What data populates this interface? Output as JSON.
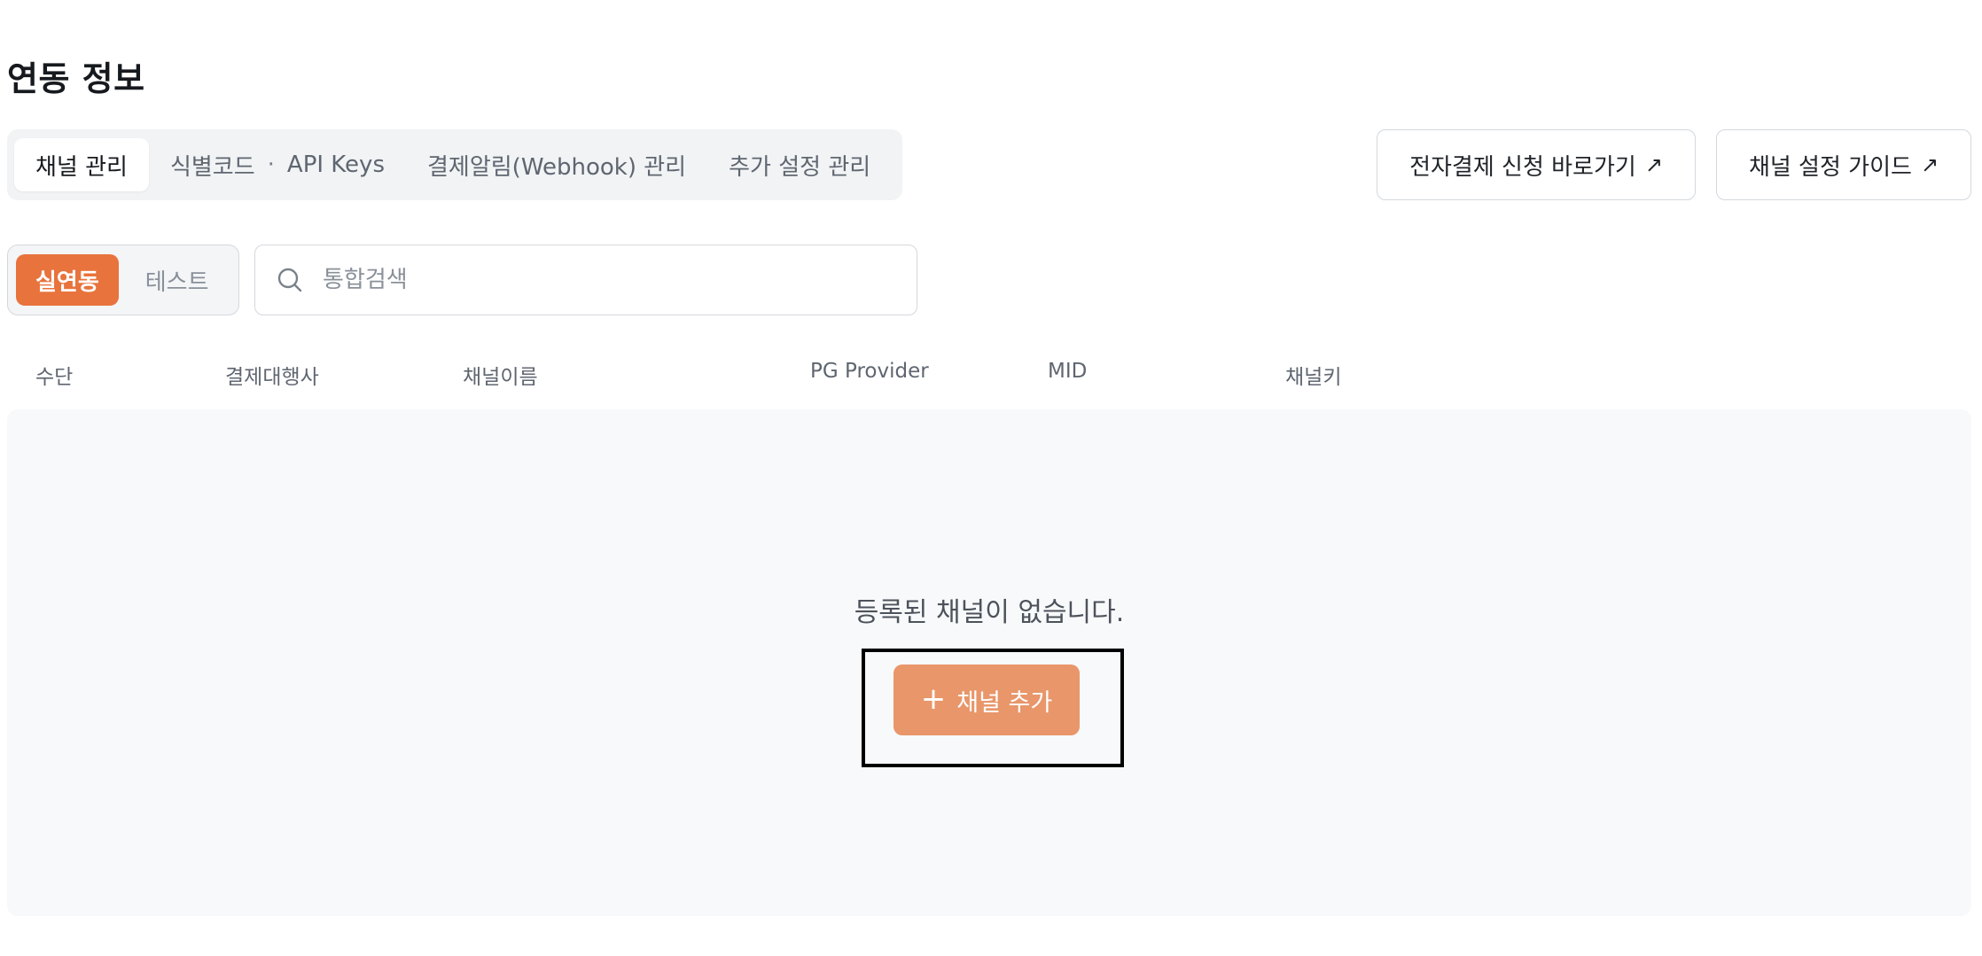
{
  "page": {
    "title": "연동 정보"
  },
  "tabs": [
    {
      "label": "채널 관리",
      "active": true
    },
    {
      "label": "식별코드",
      "label2": "API Keys",
      "separator": "·"
    },
    {
      "label": "결제알림(Webhook) 관리"
    },
    {
      "label": "추가 설정 관리"
    }
  ],
  "actions": {
    "apply_label": "전자결제 신청 바로가기",
    "guide_label": "채널 설정 가이드",
    "arrow": "↗"
  },
  "env_toggle": {
    "live": "실연동",
    "test": "테스트",
    "selected": "live"
  },
  "search": {
    "placeholder": "통합검색",
    "value": ""
  },
  "table": {
    "columns": [
      "수단",
      "결제대행사",
      "채널이름",
      "PG Provider",
      "MID",
      "채널키"
    ]
  },
  "empty_state": {
    "message": "등록된 채널이 없습니다.",
    "add_button": "채널 추가",
    "add_icon": "+"
  },
  "colors": {
    "accent": "#e8733d",
    "accent_soft": "#e8966a",
    "panel_bg": "#f8f9fa"
  }
}
